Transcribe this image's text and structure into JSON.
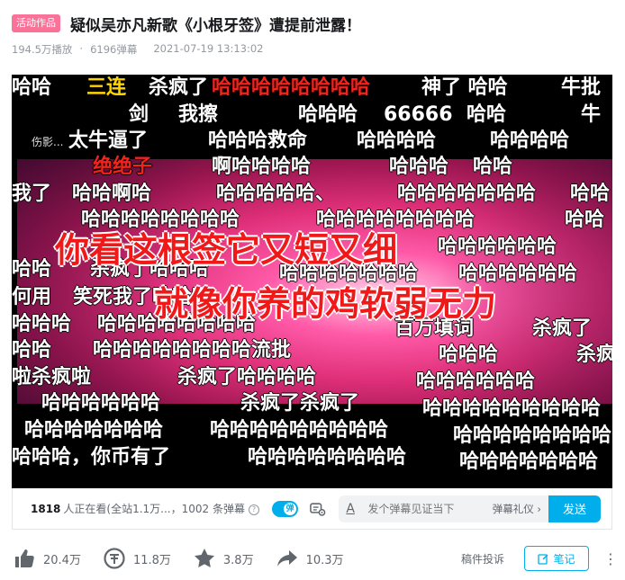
{
  "video": {
    "tag": "活动作品",
    "title": "疑似吴亦凡新歌《小根牙签》遭提前泄露！",
    "plays": "194.5万播放",
    "danmaku_count": "6196弹幕",
    "date": "2021-07-19 13:13:02"
  },
  "player": {
    "watermark": "伤影..."
  },
  "danmaku": [
    {
      "text": "哈哈",
      "color": "white"
    },
    {
      "text": "三连",
      "color": "yellow"
    },
    {
      "text": "杀疯了",
      "color": "white"
    },
    {
      "text": "哈哈哈哈哈哈哈哈",
      "color": "red"
    },
    {
      "text": "神了 哈哈",
      "color": "white"
    },
    {
      "text": "牛批",
      "color": "white"
    },
    {
      "text": "剑",
      "color": "white"
    },
    {
      "text": "我擦",
      "color": "white"
    },
    {
      "text": "哈哈哈",
      "color": "white"
    },
    {
      "text": "66666",
      "color": "white"
    },
    {
      "text": "哈哈",
      "color": "white"
    },
    {
      "text": "牛",
      "color": "white"
    },
    {
      "text": "太牛逼了",
      "color": "white"
    },
    {
      "text": "哈哈哈救命",
      "color": "white"
    },
    {
      "text": "哈哈哈哈",
      "color": "white"
    },
    {
      "text": "哈哈哈哈",
      "color": "white"
    },
    {
      "text": "绝绝子",
      "color": "red"
    },
    {
      "text": "啊哈哈哈哈",
      "color": "white"
    },
    {
      "text": "哈哈哈",
      "color": "white"
    },
    {
      "text": "哈哈",
      "color": "white"
    },
    {
      "text": "我了",
      "color": "white"
    },
    {
      "text": "哈哈啊哈",
      "color": "white"
    },
    {
      "text": "哈哈哈哈哈、",
      "color": "white"
    },
    {
      "text": "哈哈哈哈哈哈哈",
      "color": "white"
    },
    {
      "text": "哈哈",
      "color": "white"
    },
    {
      "text": "哈哈哈哈哈哈哈哈",
      "color": "white"
    },
    {
      "text": "哈哈哈哈哈哈哈哈",
      "color": "white"
    },
    {
      "text": "哈哈",
      "color": "white"
    },
    {
      "text": "哈哈哈哈哈哈",
      "color": "white"
    },
    {
      "text": "哈哈",
      "color": "white"
    },
    {
      "text": "杀疯了哈哈哈",
      "color": "white"
    },
    {
      "text": "哈哈哈哈哈哈哈",
      "color": "white"
    },
    {
      "text": "哈哈哈哈哈哈",
      "color": "white"
    },
    {
      "text": "何用",
      "color": "white"
    },
    {
      "text": "笑死我了哈哈哈",
      "color": "white"
    },
    {
      "text": "哈哈哈",
      "color": "white"
    },
    {
      "text": "哈哈哈哈哈哈哈哈",
      "color": "white"
    },
    {
      "text": "百万填词",
      "color": "white"
    },
    {
      "text": "杀疯了",
      "color": "white"
    },
    {
      "text": "哈哈",
      "color": "white"
    },
    {
      "text": "哈哈哈哈哈哈哈哈流批",
      "color": "white"
    },
    {
      "text": "哈哈哈",
      "color": "white"
    },
    {
      "text": "杀疯",
      "color": "white"
    },
    {
      "text": "啦杀疯啦",
      "color": "white"
    },
    {
      "text": "杀疯了哈哈哈哈",
      "color": "white"
    },
    {
      "text": "哈哈哈哈哈哈",
      "color": "white"
    },
    {
      "text": "哈哈哈哈哈哈",
      "color": "white"
    },
    {
      "text": "杀疯了杀疯了",
      "color": "white"
    },
    {
      "text": "哈哈哈哈哈哈哈哈哈",
      "color": "white"
    },
    {
      "text": "哈哈哈哈哈哈哈",
      "color": "white"
    },
    {
      "text": "哈哈哈哈哈哈哈哈哈",
      "color": "white"
    },
    {
      "text": "哈哈哈哈哈哈哈哈",
      "color": "white"
    },
    {
      "text": "哈哈哈，你币有了",
      "color": "white"
    },
    {
      "text": "哈哈哈哈哈哈哈哈",
      "color": "white"
    },
    {
      "text": "哈哈哈哈哈哈哈",
      "color": "white"
    },
    {
      "text": "你看这根签它又短又细",
      "color": "bigred"
    },
    {
      "text": "就像你养的鸡软弱无力",
      "color": "bigred"
    }
  ],
  "controls": {
    "viewers_count": "1818",
    "viewers_text": "人正在看(全站1.1万...，1002 条弹幕",
    "help": "?",
    "toggle_label": "弹",
    "font_icon": "A",
    "input_placeholder": "发个弹幕见证当下",
    "etiquette": "弹幕礼仪 ›",
    "send": "发送"
  },
  "toolbar": {
    "likes": "20.4万",
    "coins": "11.8万",
    "favorites": "3.8万",
    "shares": "10.3万",
    "report": "稿件投诉",
    "notes": "笔记",
    "more": "⋮"
  },
  "colors": {
    "accent": "#00aeec",
    "tag": "#fb7299",
    "danmaku_red": "#f5221b",
    "danmaku_yellow": "#ffd400"
  }
}
